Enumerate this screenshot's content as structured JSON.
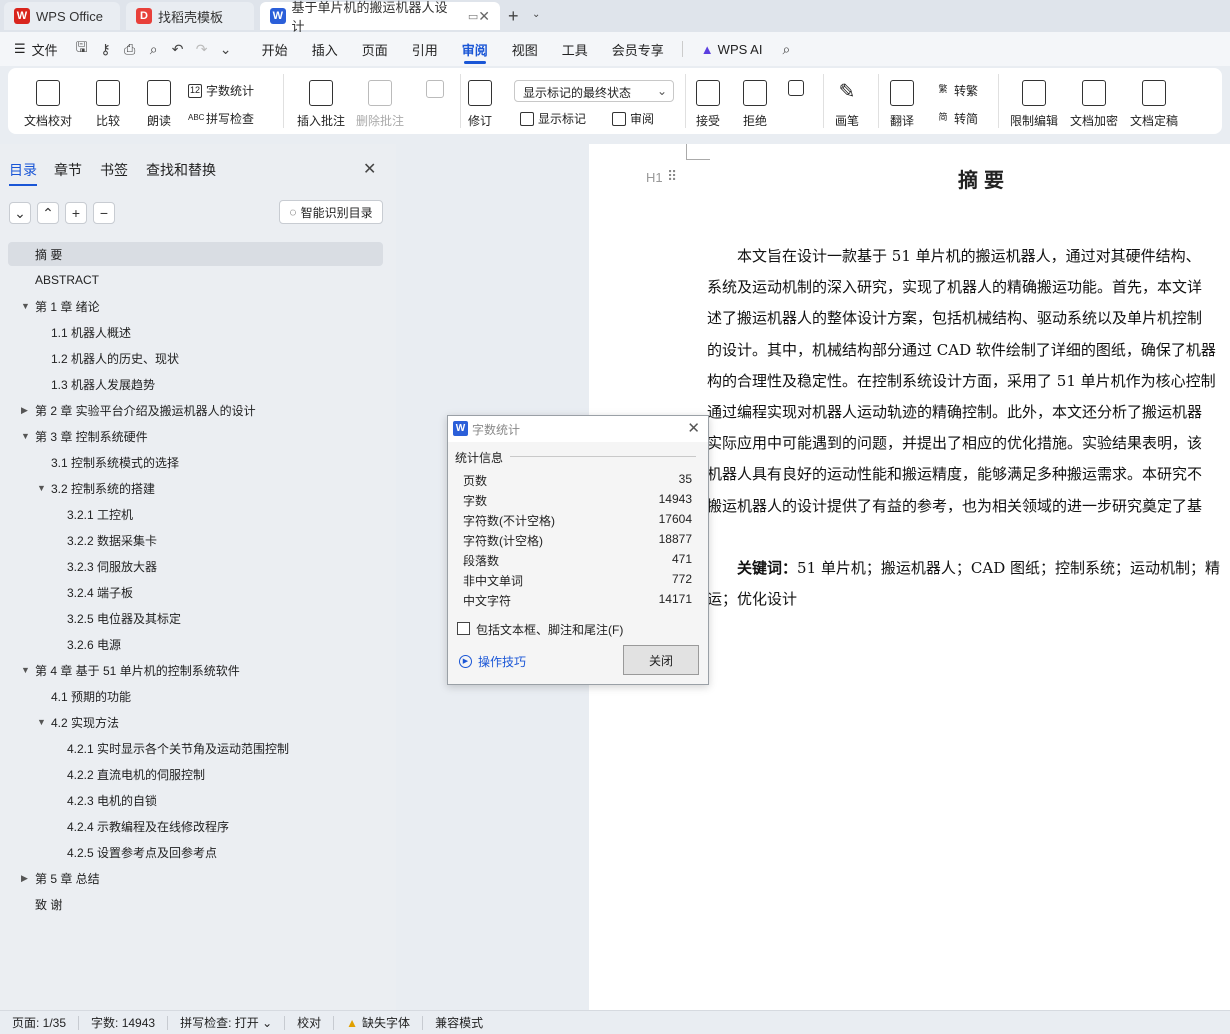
{
  "tabs": [
    {
      "label": "WPS Office"
    },
    {
      "label": "找稻壳模板"
    },
    {
      "label": "基于单片机的搬运机器人设计"
    }
  ],
  "menu": {
    "file": "文件",
    "items": [
      "开始",
      "插入",
      "页面",
      "引用",
      "审阅",
      "视图",
      "工具",
      "会员专享"
    ],
    "active": "审阅",
    "ai": "WPS AI"
  },
  "ribbon": {
    "doc_proofread": "文档校对",
    "compare": "比较",
    "read_aloud": "朗读",
    "word_count": "字数统计",
    "spell_check": "拼写检查",
    "insert_comment": "插入批注",
    "delete_comment": "删除批注",
    "revise": "修订",
    "markup_state": "显示标记的最终状态",
    "show_markup": "显示标记",
    "review": "审阅",
    "accept": "接受",
    "reject": "拒绝",
    "pen": "画笔",
    "translate": "翻译",
    "to_traditional": "转繁",
    "to_simplified": "转简",
    "restrict_edit": "限制编辑",
    "encrypt": "文档加密",
    "finalize": "文档定稿"
  },
  "nav": {
    "tabs": [
      "目录",
      "章节",
      "书签",
      "查找和替换"
    ],
    "smart_toc": "智能识别目录",
    "toc": [
      {
        "text": "摘 要",
        "level": 1
      },
      {
        "text": "ABSTRACT",
        "level": 1
      },
      {
        "text": "第 1 章  绪论",
        "level": 1,
        "arrow": "down"
      },
      {
        "text": "1.1  机器人概述",
        "level": 2
      },
      {
        "text": "1.2  机器人的历史、现状",
        "level": 2
      },
      {
        "text": "1.3  机器人发展趋势",
        "level": 2
      },
      {
        "text": "第 2 章  实验平台介绍及搬运机器人的设计",
        "level": 1,
        "arrow": "right"
      },
      {
        "text": "第 3 章  控制系统硬件",
        "level": 1,
        "arrow": "down"
      },
      {
        "text": "3.1  控制系统模式的选择",
        "level": 2
      },
      {
        "text": "3.2 控制系统的搭建",
        "level": 2,
        "arrow": "down"
      },
      {
        "text": "3.2.1 工控机",
        "level": 3
      },
      {
        "text": "3.2.2 数据采集卡",
        "level": 3
      },
      {
        "text": "3.2.3 伺服放大器",
        "level": 3
      },
      {
        "text": "3.2.4 端子板",
        "level": 3
      },
      {
        "text": "3.2.5 电位器及其标定",
        "level": 3
      },
      {
        "text": "3.2.6 电源",
        "level": 3
      },
      {
        "text": "第 4 章  基于 51 单片机的控制系统软件",
        "level": 1,
        "arrow": "down"
      },
      {
        "text": "4.1 预期的功能",
        "level": 2
      },
      {
        "text": "4.2  实现方法",
        "level": 2,
        "arrow": "down"
      },
      {
        "text": "4.2.1 实时显示各个关节角及运动范围控制",
        "level": 3
      },
      {
        "text": "4.2.2 直流电机的伺服控制",
        "level": 3
      },
      {
        "text": "4.2.3 电机的自锁",
        "level": 3
      },
      {
        "text": "4.2.4 示教编程及在线修改程序",
        "level": 3
      },
      {
        "text": "4.2.5 设置参考点及回参考点",
        "level": 3
      },
      {
        "text": "第 5 章  总结",
        "level": 1,
        "arrow": "right"
      },
      {
        "text": "致  谢",
        "level": 1
      }
    ]
  },
  "document": {
    "heading": "摘要",
    "heading_marker": "H1",
    "lines": [
      "　　本文旨在设计一款基于 51 单片机的搬运机器人，通过对其硬件结构、",
      "系统及运动机制的深入研究，实现了机器人的精确搬运功能。首先，本文详",
      "述了搬运机器人的整体设计方案，包括机械结构、驱动系统以及单片机控制",
      "的设计。其中，机械结构部分通过 CAD 软件绘制了详细的图纸，确保了机器",
      "构的合理性及稳定性。在控制系统设计方面，采用了 51 单片机作为核心控制",
      "通过编程实现对机器人运动轨迹的精确控制。此外，本文还分析了搬运机器",
      "实际应用中可能遇到的问题，并提出了相应的优化措施。实验结果表明，该",
      "机器人具有良好的运动性能和搬运精度，能够满足多种搬运需求。本研究不",
      "搬运机器人的设计提供了有益的参考，也为相关领域的进一步研究奠定了基"
    ],
    "keywords_label": "关键词：",
    "keywords_line1": "51 单片机；搬运机器人；CAD 图纸；控制系统；运动机制；精",
    "keywords_line2": "运；优化设计"
  },
  "dialog": {
    "title": "字数统计",
    "group": "统计信息",
    "stats": [
      {
        "label": "页数",
        "value": "35"
      },
      {
        "label": "字数",
        "value": "14943"
      },
      {
        "label": "字符数(不计空格)",
        "value": "17604"
      },
      {
        "label": "字符数(计空格)",
        "value": "18877"
      },
      {
        "label": "段落数",
        "value": "471"
      },
      {
        "label": "非中文单词",
        "value": "772"
      },
      {
        "label": "中文字符",
        "value": "14171"
      }
    ],
    "checkbox_label": "包括文本框、脚注和尾注(F)",
    "tips": "操作技巧",
    "close": "关闭"
  },
  "status": {
    "page": "页面: 1/35",
    "words": "字数: 14943",
    "spell": "拼写检查: 打开",
    "proof": "校对",
    "missing_font": "缺失字体",
    "compat": "兼容模式"
  },
  "colors": {
    "accent": "#1a56d6",
    "wps_red": "#d9251d",
    "word_blue": "#2b5fd9"
  }
}
